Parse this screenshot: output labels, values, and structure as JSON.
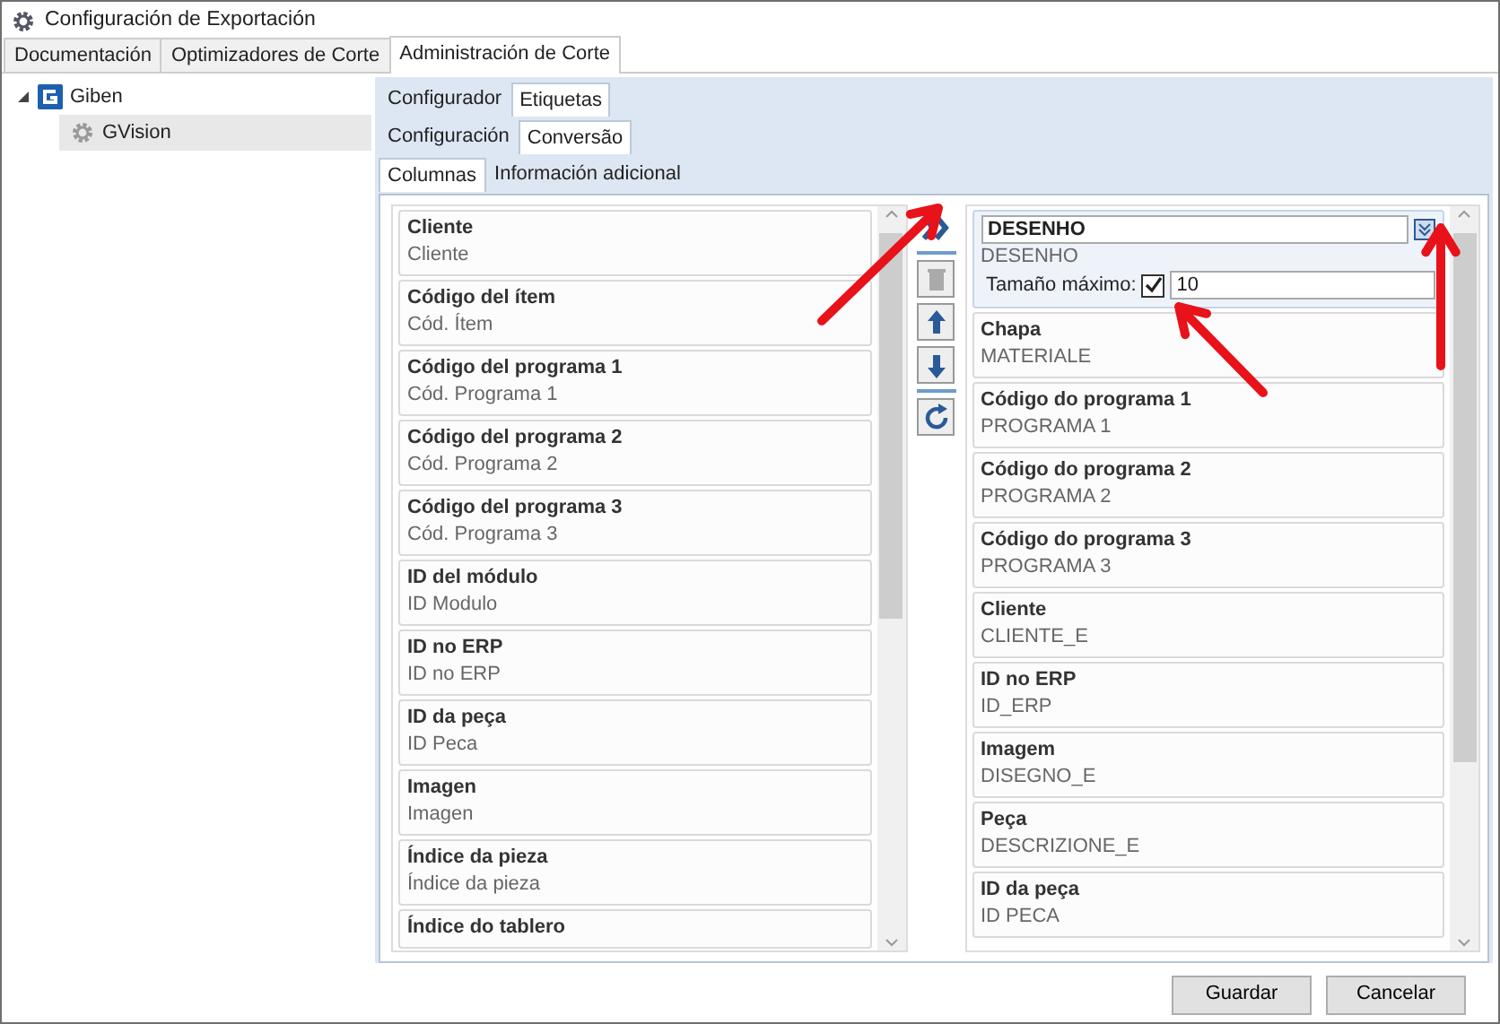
{
  "window": {
    "title": "Configuración de Exportación"
  },
  "tabs": [
    {
      "label": "Documentación",
      "selected": false
    },
    {
      "label": "Optimizadores de Corte",
      "selected": false
    },
    {
      "label": "Administración de Corte",
      "selected": true
    }
  ],
  "tree": [
    {
      "label": "Giben",
      "expanded": true,
      "selected": false,
      "children": [
        {
          "label": "GVision",
          "selected": true
        }
      ]
    }
  ],
  "config_tabs": [
    {
      "label": "Configurador",
      "selected": false
    },
    {
      "label": "Etiquetas",
      "selected": true
    }
  ],
  "label_tabs": [
    {
      "label": "Configuración",
      "selected": false
    },
    {
      "label": "Conversão",
      "selected": true
    }
  ],
  "column_tabs": [
    {
      "label": "Columnas",
      "selected": true
    },
    {
      "label": "Información adicional",
      "selected": false
    }
  ],
  "available_columns": [
    {
      "title": "Cliente",
      "subtitle": "Cliente"
    },
    {
      "title": "Código del ítem",
      "subtitle": "Cód. Ítem"
    },
    {
      "title": "Código del programa 1",
      "subtitle": "Cód. Programa 1"
    },
    {
      "title": "Código del programa 2",
      "subtitle": "Cód. Programa 2"
    },
    {
      "title": "Código del programa 3",
      "subtitle": "Cód. Programa 3"
    },
    {
      "title": "ID del módulo",
      "subtitle": "ID Modulo"
    },
    {
      "title": "ID no ERP",
      "subtitle": "ID no ERP"
    },
    {
      "title": "ID da peça",
      "subtitle": "ID Peca"
    },
    {
      "title": "Imagen",
      "subtitle": "Imagen"
    },
    {
      "title": "Índice da pieza",
      "subtitle": "Índice da pieza"
    },
    {
      "title": "Índice do tablero"
    }
  ],
  "toolbar": [
    {
      "kind": "add",
      "disabled": false
    },
    {
      "kind": "delete",
      "disabled": true
    },
    {
      "kind": "up",
      "disabled": false
    },
    {
      "kind": "down",
      "disabled": false
    },
    {
      "kind": "refresh",
      "disabled": false
    }
  ],
  "selected_columns": [
    {
      "kind": "editor",
      "title": "DESENHO",
      "subtitle": "DESENHO",
      "max_size_label": "Tamaño máximo:",
      "max_size_enabled": true,
      "max_size": "10"
    },
    {
      "kind": "item",
      "title": "Chapa",
      "subtitle": "MATERIALE"
    },
    {
      "kind": "item",
      "title": "Código do programa 1",
      "subtitle": "PROGRAMA 1"
    },
    {
      "kind": "item",
      "title": "Código do programa 2",
      "subtitle": "PROGRAMA 2"
    },
    {
      "kind": "item",
      "title": "Código do programa 3",
      "subtitle": "PROGRAMA 3"
    },
    {
      "kind": "item",
      "title": "Cliente",
      "subtitle": "CLIENTE_E"
    },
    {
      "kind": "item",
      "title": "ID no ERP",
      "subtitle": "ID_ERP"
    },
    {
      "kind": "item",
      "title": "Imagem",
      "subtitle": "DISEGNO_E"
    },
    {
      "kind": "item",
      "title": "Peça",
      "subtitle": "DESCRIZIONE_E"
    },
    {
      "kind": "item",
      "title": "ID da peça",
      "subtitle": "ID PECA"
    }
  ],
  "buttons": [
    "Guardar",
    "Cancelar"
  ]
}
